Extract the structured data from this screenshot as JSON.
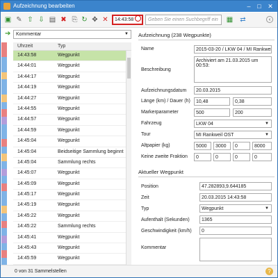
{
  "window": {
    "title": "Aufzeichnung bearbeiten"
  },
  "toolbar": {
    "time_value": "14:43:58",
    "search_placeholder": "Geben Sie einen Suchbegriff ein"
  },
  "filter": {
    "selected": "Kommentar"
  },
  "list": {
    "col_time": "Uhrzeit",
    "col_type": "Typ",
    "rows": [
      {
        "time": "14:43:58",
        "type": "Wegpunkt"
      },
      {
        "time": "14:44:01",
        "type": "Wegpunkt"
      },
      {
        "time": "14:44:17",
        "type": "Wegpunkt"
      },
      {
        "time": "14:44:19",
        "type": "Wegpunkt"
      },
      {
        "time": "14:44:27",
        "type": "Wegpunkt"
      },
      {
        "time": "14:44:55",
        "type": "Wegpunkt"
      },
      {
        "time": "14:44:57",
        "type": "Wegpunkt"
      },
      {
        "time": "14:44:59",
        "type": "Wegpunkt"
      },
      {
        "time": "14:45:04",
        "type": "Wegpunkt"
      },
      {
        "time": "14:45:04",
        "type": "Beidseitige Sammlung beginnt"
      },
      {
        "time": "14:45:04",
        "type": "Sammlung rechts"
      },
      {
        "time": "14:45:07",
        "type": "Wegpunkt"
      },
      {
        "time": "14:45:09",
        "type": "Wegpunkt"
      },
      {
        "time": "14:45:17",
        "type": "Wegpunkt"
      },
      {
        "time": "14:45:19",
        "type": "Wegpunkt"
      },
      {
        "time": "14:45:22",
        "type": "Wegpunkt"
      },
      {
        "time": "14:45:22",
        "type": "Sammlung rechts"
      },
      {
        "time": "14:45:41",
        "type": "Wegpunkt"
      },
      {
        "time": "14:45:43",
        "type": "Wegpunkt"
      },
      {
        "time": "14:45:59",
        "type": "Wegpunkt"
      }
    ]
  },
  "status": {
    "text": "0 von 31 Sammelstellen"
  },
  "recording": {
    "heading": "Aufzeichnung (238 Wegpunkte)",
    "name_label": "Name",
    "name_value": "2015-03-20 / LKW 04 / MI Rankweil",
    "desc_label": "Beschreibung",
    "desc_value": "Archiviert am 21.03.2015 um 00:53:",
    "date_label": "Aufzeichnungsdatum",
    "date_value": "20.03.2015",
    "length_label": "Länge (km) / Dauer (h)",
    "length_value": "10,48",
    "duration_value": "0,38",
    "marker_label": "Markerparameter",
    "marker_a": "500",
    "marker_b": "200",
    "vehicle_label": "Fahrzeug",
    "vehicle_value": "LKW 04",
    "tour_label": "Tour",
    "tour_value": "MI Rankweil OST",
    "paper_label": "Altpapier (kg)",
    "paper_values": [
      "5000",
      "3000",
      "0",
      "8000"
    ],
    "fraction_label": "Keine zweite Fraktion",
    "fraction_values": [
      "0",
      "0",
      "0",
      "0"
    ]
  },
  "waypoint": {
    "heading": "Aktueller Wegpunkt",
    "pos_label": "Position",
    "pos_value": "47.282893,9.644185",
    "time_label": "Zeit",
    "time_value": "20.03.2015 14:43:58",
    "type_label": "Typ",
    "type_value": "Wegpunkt",
    "stay_label": "Aufenthalt (Sekunden)",
    "stay_value": "1365",
    "speed_label": "Geschwindigkeit (km/h)",
    "speed_value": "0",
    "comment_label": "Kommentar",
    "comment_value": ""
  },
  "colors": {
    "strips": [
      "#e88080",
      "#e88080",
      "#7fb3e6",
      "#7fb3e6",
      "#f4c57a",
      "#7fb3e6",
      "#7fb3e6",
      "#f4c57a",
      "#7fb3e6",
      "#e88080",
      "#b39ddb",
      "#7fb3e6",
      "#7fb3e6",
      "#e88080",
      "#7fb3e6",
      "#f4c57a",
      "#7fb3e6",
      "#b39ddb",
      "#7fb3e6",
      "#e88080",
      "#7fb3e6",
      "#7fb3e6",
      "#f4c57a",
      "#7fb3e6",
      "#e88080",
      "#7fb3e6",
      "#b39ddb",
      "#7fb3e6",
      "#e88080",
      "#7fb3e6"
    ]
  }
}
